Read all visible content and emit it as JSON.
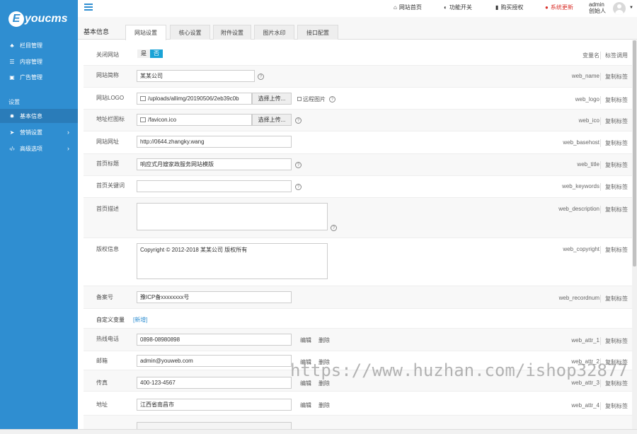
{
  "app": {
    "logo_letter": "E",
    "logo_text": "youcms"
  },
  "sidebar": {
    "items_top": [
      {
        "label": "栏目管理",
        "icon": "sitemap-icon"
      },
      {
        "label": "内容管理",
        "icon": "list-icon"
      },
      {
        "label": "广告管理",
        "icon": "image-icon"
      }
    ],
    "section_label": "设置",
    "items_settings": [
      {
        "label": "基本信息",
        "icon": "gear-icon",
        "active": true
      },
      {
        "label": "营销设置",
        "icon": "send-icon"
      },
      {
        "label": "高级选项",
        "icon": "code-icon"
      }
    ]
  },
  "topbar": {
    "links": [
      {
        "label": "网站首页",
        "icon": "home-icon"
      },
      {
        "label": "功能开关",
        "icon": "toggle-icon"
      },
      {
        "label": "购买授权",
        "icon": "bookmark-icon"
      },
      {
        "label": "系统更新",
        "icon": "alert-icon",
        "color": "#d9302a"
      }
    ],
    "user_name": "admin",
    "user_role": "创始人"
  },
  "tabs": {
    "title": "基本信息",
    "items": [
      "网站设置",
      "核心设置",
      "附件设置",
      "图片水印",
      "接口配置"
    ],
    "active": 0
  },
  "form": {
    "header": {
      "var_col": "变量名",
      "tag_col": "标签调用"
    },
    "close_site": {
      "label": "关闭网站",
      "yes": "是",
      "no": "否"
    },
    "copy_label": "复制标签",
    "rows": [
      {
        "label": "网站简称",
        "value": "某某公司",
        "var": "web_name"
      },
      {
        "label": "网站LOGO",
        "value": "/uploads/allimg/20190506/2eb39c0b",
        "var": "web_logo",
        "upload": "选择上传...",
        "remote": "远程图片"
      },
      {
        "label": "地址栏图标",
        "value": "/favicon.ico",
        "var": "web_ico",
        "upload": "选择上传..."
      },
      {
        "label": "网站网址",
        "value": "http://0644.zhangky.wang",
        "var": "web_basehost"
      },
      {
        "label": "首页标题",
        "value": "响应式月嫂家政服务网站模版",
        "var": "web_title"
      },
      {
        "label": "首页关键词",
        "value": "",
        "var": "web_keywords"
      },
      {
        "label": "首页描述",
        "value": "",
        "var": "web_description"
      },
      {
        "label": "版权信息",
        "value": "Copyright © 2012-2018 某某公司 版权所有",
        "var": "web_copyright"
      },
      {
        "label": "备案号",
        "value": "豫ICP备xxxxxxxx号",
        "var": "web_recordnum"
      }
    ],
    "custom": {
      "label": "自定义变量",
      "add": "[新增]"
    },
    "custom_rows": [
      {
        "label": "热线电话",
        "value": "0898-08980898",
        "var": "web_attr_1"
      },
      {
        "label": "邮箱",
        "value": "admin@youweb.com",
        "var": "web_attr_2"
      },
      {
        "label": "传真",
        "value": "400-123-4567",
        "var": "web_attr_3"
      },
      {
        "label": "地址",
        "value": "江西省南昌市",
        "var": "web_attr_4"
      }
    ],
    "edit_label": "编辑",
    "delete_label": "删除"
  },
  "watermark": "https://www.huzhan.com/ishop32877",
  "colors": {
    "sidebar": "#2f8ed1",
    "accent": "#1aa3d6",
    "update": "#d9302a"
  }
}
